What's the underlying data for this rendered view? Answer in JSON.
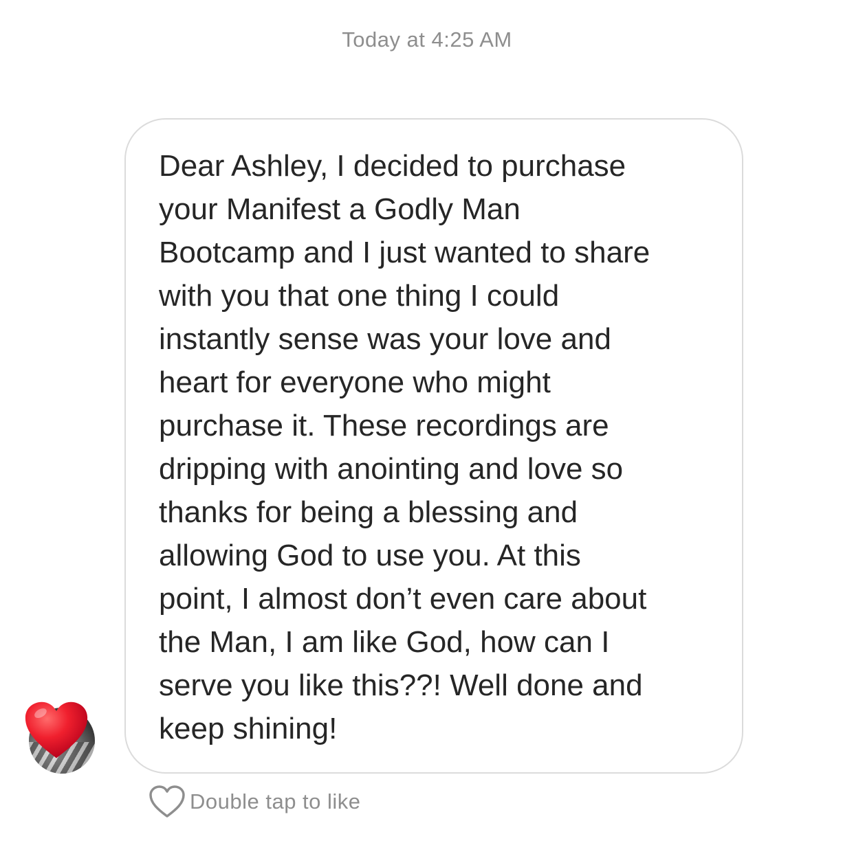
{
  "thread": {
    "timestamp": "Today at 4:25 AM"
  },
  "message": {
    "text": "Dear Ashley, I decided to purchase\nyour Manifest a Godly Man\nBootcamp and I just wanted to share\nwith you that one thing I could\ninstantly sense was your love and\nheart for everyone who might\npurchase it. These recordings are\ndripping with anointing and love so\nthanks for being a blessing and\nallowing God to use you. At this\npoint, I almost don’t even care about\nthe Man, I am like God, how can I\nserve you like this??! Well done and\nkeep shining!",
    "reaction_icon": "red-heart-icon"
  },
  "actions": {
    "like_label": "Double tap to like",
    "like_icon": "heart-outline-icon"
  },
  "colors": {
    "bubble_border": "#dbdbdb",
    "text": "#262626",
    "muted": "#8e8e8e",
    "heart": "#e0182d"
  }
}
